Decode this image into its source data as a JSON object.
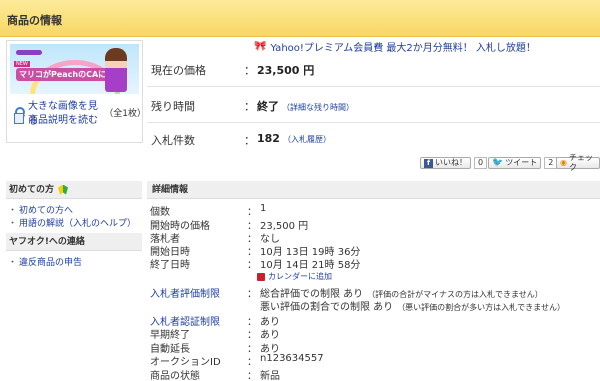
{
  "header": {
    "title": "商品の情報"
  },
  "thumbnail": {
    "new_tag": "NEW",
    "banner_text": "マリコがPeachのCAに!",
    "enlarge_label": "大きな画像を見る",
    "count_label": "（全1枚）",
    "description_label": "商品説明を読む"
  },
  "promo": {
    "text": "Yahoo!プレミアム会員費 最大2か月分無料！ 入札し放題！"
  },
  "summary": {
    "current_price_label": "現在の価格",
    "current_price_value": "23,500 円",
    "remaining_label": "残り時間",
    "remaining_value": "終了",
    "remaining_detail": "（詳細な残り時間）",
    "bids_label": "入札件数",
    "bids_value": "182",
    "bids_history": "（入札履歴）",
    "colon": "："
  },
  "social": {
    "like_label": "いいね！",
    "like_count": "0",
    "tweet_label": "ツイート",
    "tweet_count": "2",
    "check_label": "チェック"
  },
  "sidebar": {
    "beginners_head": "初めての方",
    "beginners_links": [
      "初めての方へ",
      "用語の解説（入札のヘルプ）"
    ],
    "contact_head": "ヤフオク!への連絡",
    "contact_links": [
      "違反商品の申告"
    ]
  },
  "details": {
    "head": "詳細情報",
    "rows": [
      {
        "label": "個数",
        "value": "1"
      },
      {
        "label": "開始時の価格",
        "value": "23,500 円"
      },
      {
        "label": "落札者",
        "value": "なし"
      },
      {
        "label": "開始日時",
        "value": "10月 13日 19時 36分"
      },
      {
        "label": "終了日時",
        "value": "10月 14日 21時 58分"
      }
    ],
    "calendar_label": "カレンダーに追加",
    "rating_label": "入札者評価制限",
    "rating_value_1": "総合評価での制限 あり",
    "rating_note_1": "（評価の合計がマイナスの方は入札できません）",
    "rating_value_2": "悪い評価の割合での制限 あり",
    "rating_note_2": "（悪い評価の割合が多い方は入札できません）",
    "rows2": [
      {
        "label": "入札者認証制限",
        "value": "あり"
      },
      {
        "label": "早期終了",
        "value": "あり"
      },
      {
        "label": "自動延長",
        "value": "あり"
      },
      {
        "label": "オークションID",
        "value": "n123634557"
      },
      {
        "label": "商品の状態",
        "value": "新品"
      }
    ]
  }
}
